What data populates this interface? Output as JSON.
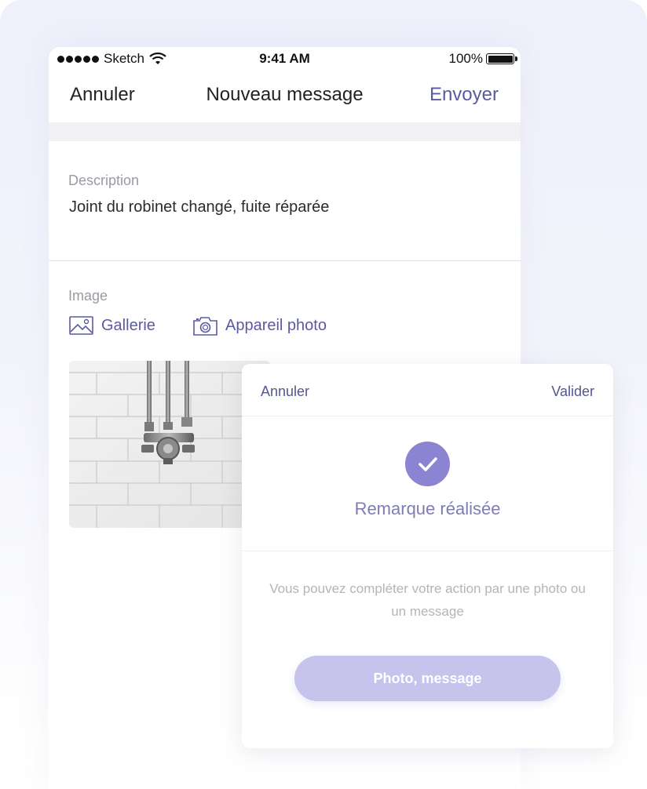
{
  "status_bar": {
    "carrier": "Sketch",
    "time": "9:41 AM",
    "battery": "100%"
  },
  "nav": {
    "cancel": "Annuler",
    "title": "Nouveau message",
    "send": "Envoyer"
  },
  "description": {
    "label": "Description",
    "value": "Joint du robinet changé, fuite réparée"
  },
  "image": {
    "label": "Image",
    "gallery": "Gallerie",
    "camera": "Appareil photo"
  },
  "dialog": {
    "cancel": "Annuler",
    "validate": "Valider",
    "title": "Remarque réalisée",
    "text": "Vous pouvez compléter votre action par une photo ou un message",
    "button": "Photo, message"
  },
  "colors": {
    "accent": "#5b5aa0",
    "check": "#8b84d2",
    "button": "#c6c3ec"
  },
  "icons": [
    "signal-dots-icon",
    "wifi-icon",
    "battery-icon",
    "gallery-icon",
    "camera-icon",
    "check-icon"
  ]
}
